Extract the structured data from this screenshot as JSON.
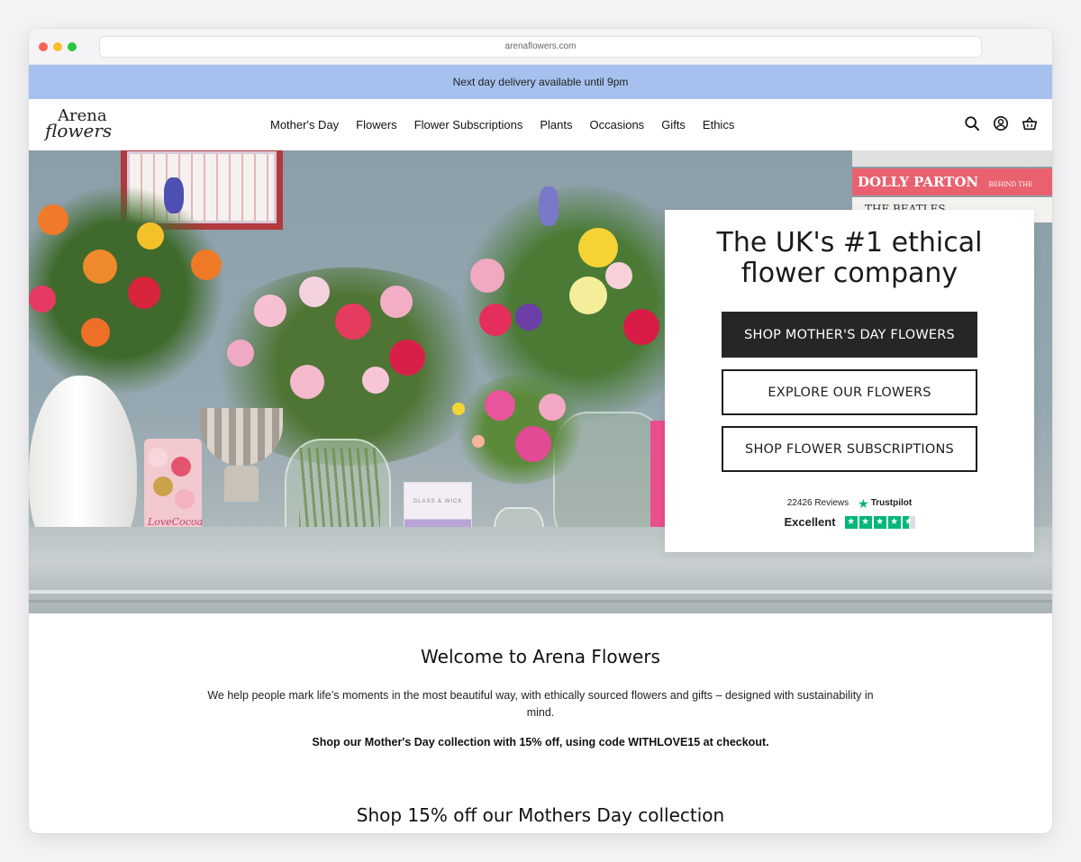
{
  "browser": {
    "url": "arenaflowers.com"
  },
  "promo_banner": {
    "text": "Next day delivery available until 9pm"
  },
  "header": {
    "logo_line1": "Arena",
    "logo_line2": "flowers",
    "nav": [
      {
        "label": "Mother's Day"
      },
      {
        "label": "Flowers"
      },
      {
        "label": "Flower Subscriptions"
      },
      {
        "label": "Plants"
      },
      {
        "label": "Occasions"
      },
      {
        "label": "Gifts"
      },
      {
        "label": "Ethics"
      }
    ],
    "icons": [
      "search-icon",
      "account-icon",
      "basket-icon"
    ]
  },
  "hero": {
    "title": "The UK's #1 ethical flower company",
    "buttons": [
      {
        "label": "SHOP MOTHER'S DAY FLOWERS",
        "style": "dark"
      },
      {
        "label": "EXPLORE OUR FLOWERS",
        "style": "outline"
      },
      {
        "label": "SHOP FLOWER SUBSCRIPTIONS",
        "style": "outline"
      }
    ],
    "reviews": {
      "count_text": "22426 Reviews",
      "brand": "Trustpilot",
      "rating_text": "Excellent",
      "stars": 4.5,
      "color": "#00b67a"
    },
    "scene_text": {
      "book_title": "DOLLY PARTON",
      "book_subtitle": "BEHIND THE SEAMS",
      "book2_title": "THE BEATLES",
      "cocoa_label": "LoveCocoa",
      "candle_label": "GLASS & WICK"
    }
  },
  "welcome": {
    "title": "Welcome to Arena Flowers",
    "description": "We help people mark life’s moments in the most beautiful way, with ethically sourced flowers and gifts – designed with sustainability in mind.",
    "promo": "Shop our Mother's Day collection with 15% off, using code WITHLOVE15 at checkout."
  },
  "collection": {
    "title": "Shop 15% off our Mothers Day collection"
  },
  "colors": {
    "banner": "#a6c1ee",
    "dark_button": "#262626",
    "trustpilot": "#00b67a"
  }
}
